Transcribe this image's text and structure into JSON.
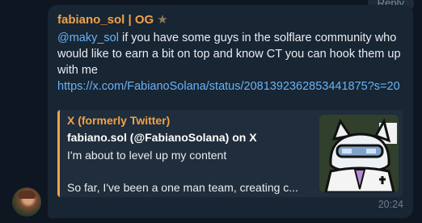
{
  "reply_button": "Reply",
  "message": {
    "author": "fabiano_sol | OG",
    "mention": "@maky_sol",
    "text": " if you have some guys in the solflare community who would like to earn a bit on top and know CT you can hook them up with me",
    "link": "https://x.com/FabianoSolana/status/2081392362853441875?s=20",
    "time": "20:24"
  },
  "preview": {
    "site": "X (formerly Twitter)",
    "title": "fabiano.sol (@FabianoSolana) on X",
    "line1": "I'm about to level up my content",
    "line2": "",
    "line3": "So far, I've been a one man team, creating c..."
  },
  "colors": {
    "background": "#0e1621",
    "bubble": "#182533",
    "accent": "#f0a24a",
    "link": "#6ab3f3"
  },
  "icons": {
    "badge": "star-icon"
  }
}
